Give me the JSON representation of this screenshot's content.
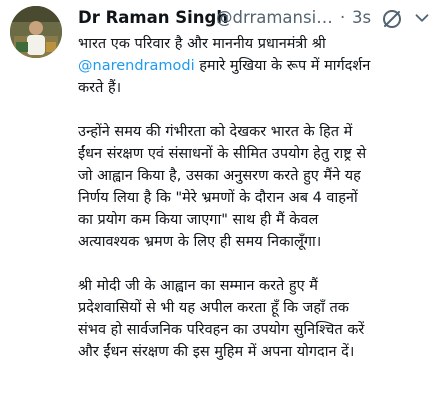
{
  "tweet": {
    "author_name": "Dr Raman Singh",
    "author_handle": "@drramansingh",
    "separator": "·",
    "timestamp": "3s",
    "icons": {
      "avatar": "profile-photo",
      "edited": "slashed-circle-icon",
      "more": "more-options-icon"
    },
    "colors": {
      "text": "#0f1419",
      "secondary": "#536471",
      "link": "#1d9bf0"
    },
    "paragraph1": {
      "line1": "भारत एक परिवार है और माननीय प्रधानमंत्री श्री",
      "mention": "@narendramodi",
      "line2_rest": " हमारे मुखिया के रूप में मार्गदर्शन",
      "line3": "करते हैं।"
    },
    "paragraph2": {
      "lines": [
        "उन्होंने समय की गंभीरता को देखकर भारत के हित में",
        "ईंधन संरक्षण एवं संसाधनों के सीमित उपयोग हेतु राष्ट्र से",
        "जो आह्वान किया है, उसका अनुसरण करते हुए मैंने यह",
        "निर्णय लिया है कि \"मेरे भ्रमणों के दौरान अब 4 वाहनों",
        "का प्रयोग कम किया जाएगा\" साथ ही मैं केवल",
        "अत्यावश्यक भ्रमण के लिए ही समय निकालूँगा।"
      ]
    },
    "paragraph3": {
      "lines": [
        "श्री मोदी जी के आह्वान का सम्मान करते हुए मैं",
        "प्रदेशवासियों से भी यह अपील करता हूँ कि जहाँ तक",
        "संभव हो सार्वजनिक परिवहन का उपयोग सुनिश्चित करें",
        "और ईंधन संरक्षण की इस मुहिम में अपना योगदान दें।"
      ]
    }
  }
}
